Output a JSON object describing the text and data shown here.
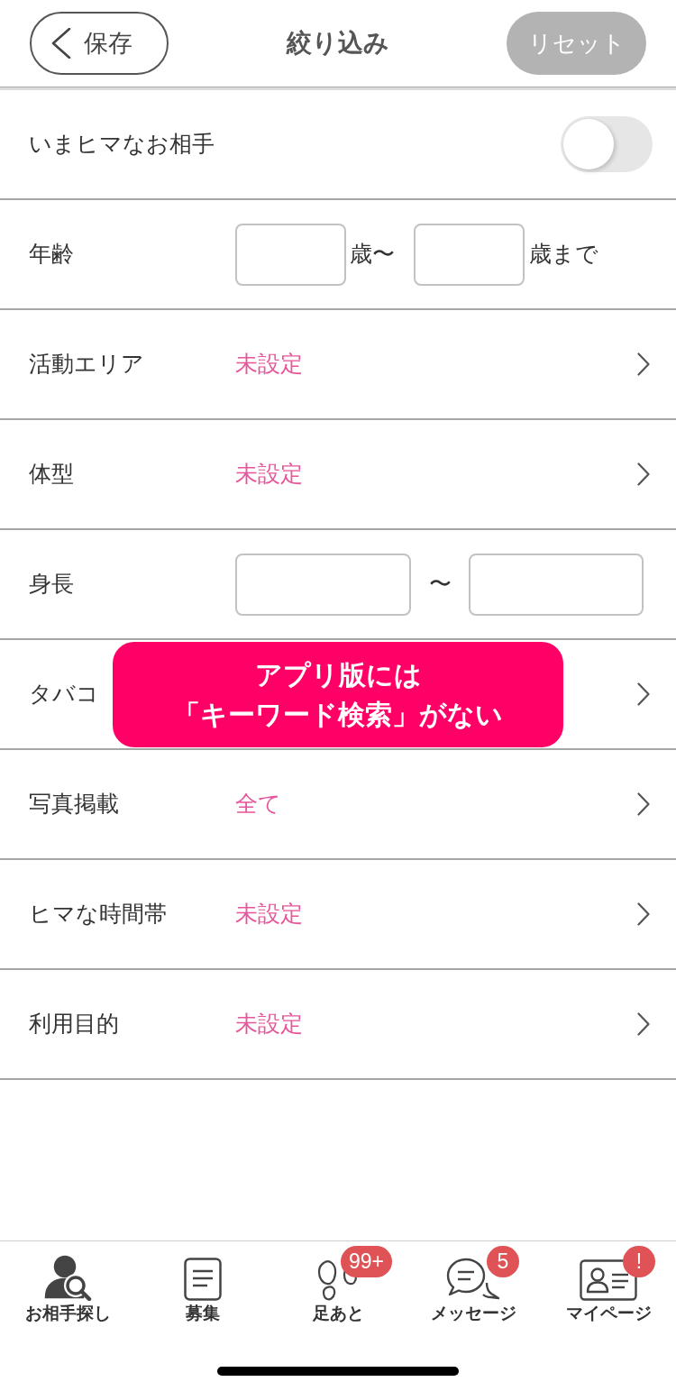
{
  "header": {
    "back_button": "保存",
    "title": "絞り込み",
    "reset_button": "リセット"
  },
  "filters": [
    {
      "kind": "toggle",
      "label": "いまヒマなお相手",
      "on": false
    },
    {
      "kind": "age_range",
      "label": "年齢",
      "from_unit": "歳〜",
      "to_unit": "歳まで"
    },
    {
      "kind": "select",
      "label": "活動エリア",
      "value": "未設定"
    },
    {
      "kind": "select",
      "label": "体型",
      "value": "未設定"
    },
    {
      "kind": "height_range",
      "label": "身長",
      "separator": "〜"
    },
    {
      "kind": "select",
      "label": "タバコ"
    },
    {
      "kind": "select",
      "label": "写真掲載",
      "value": "全て"
    },
    {
      "kind": "select",
      "label": "ヒマな時間帯",
      "value": "未設定"
    },
    {
      "kind": "select",
      "label": "利用目的",
      "value": "未設定"
    }
  ],
  "callout": {
    "lines": [
      "アプリ版には",
      "「キーワード検索」がない"
    ]
  },
  "tab_bar": [
    {
      "label": "お相手探し",
      "selected": true
    },
    {
      "label": "募集",
      "selected": false
    },
    {
      "label": "足あと",
      "selected": false,
      "badge": "99+"
    },
    {
      "label": "メッセージ",
      "selected": false,
      "badge": "5"
    },
    {
      "label": "マイページ",
      "selected": false,
      "badge": "!"
    }
  ]
}
